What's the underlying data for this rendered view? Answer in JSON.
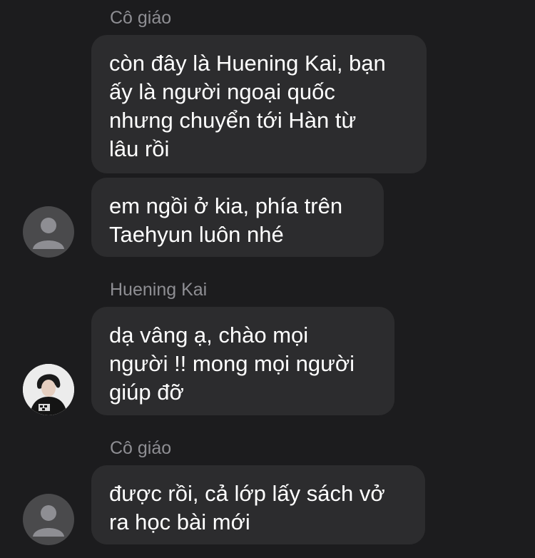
{
  "conversation": {
    "messages": [
      {
        "sender": "Cô giáo",
        "bubbles": [
          "còn đây là Huening Kai, bạn\nấy là người ngoại quốc\nnhưng chuyển tới Hàn từ\nlâu rồi",
          "em ngồi ở kia, phía trên\nTaehyun luôn nhé"
        ]
      },
      {
        "sender": "Huening Kai",
        "bubbles": [
          "dạ vâng ạ, chào mọi\nngười !! mong mọi người\ngiúp đỡ"
        ]
      },
      {
        "sender": "Cô giáo",
        "bubbles": [
          "được rồi, cả lớp lấy sách vở\nra học bài mới"
        ]
      }
    ]
  },
  "colors": {
    "background": "#1c1c1e",
    "bubble": "#2c2c2e",
    "sender_name": "#8e8e93",
    "message_text": "#ffffff",
    "default_avatar": "#4a4a4c"
  },
  "icons": [
    "default-avatar-icon",
    "profile-photo"
  ]
}
